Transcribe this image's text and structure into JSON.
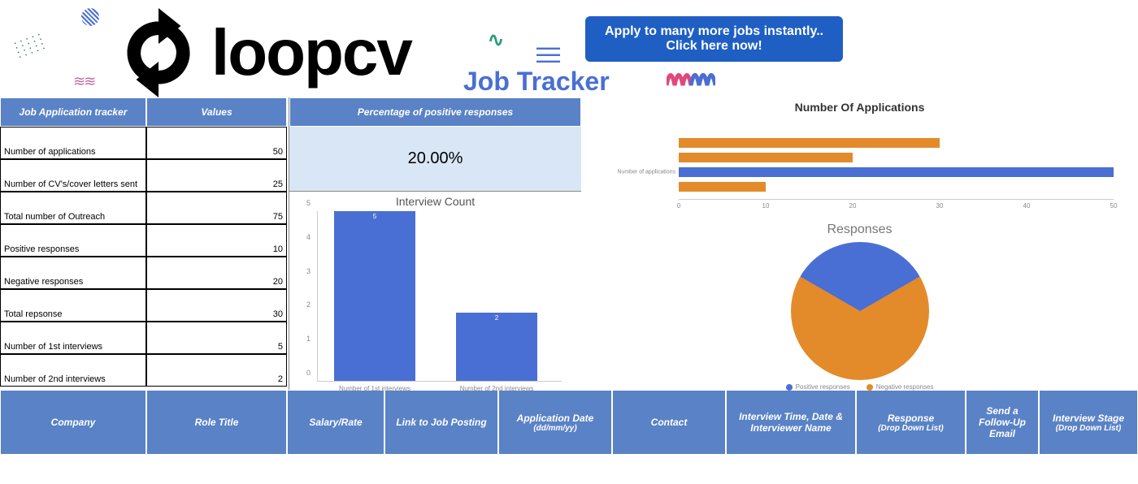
{
  "header": {
    "logo_text": "loopcv",
    "tracker_label": "Job Tracker",
    "apply_button_line1": "Apply to many more jobs instantly..",
    "apply_button_line2": "Click here now!"
  },
  "stats_table": {
    "header_label": "Job Application tracker",
    "header_values": "Values",
    "rows": [
      {
        "label": "Number of applications",
        "value": "50"
      },
      {
        "label": "Number of CV's/cover letters sent",
        "value": "25"
      },
      {
        "label": "Total number of Outreach",
        "value": "75"
      },
      {
        "label": "Positive responses",
        "value": "10"
      },
      {
        "label": "Negative responses",
        "value": "20"
      },
      {
        "label": "Total repsonse",
        "value": "30"
      },
      {
        "label": "Number of 1st interviews",
        "value": "5"
      },
      {
        "label": "Number of 2nd interviews",
        "value": "2"
      }
    ]
  },
  "percentage_panel": {
    "header": "Percentage of positive responses",
    "value": "20.00%"
  },
  "bottom_columns": [
    {
      "label": "Company",
      "sub": ""
    },
    {
      "label": "Role Title",
      "sub": ""
    },
    {
      "label": "Salary/Rate",
      "sub": ""
    },
    {
      "label": "Link to Job Posting",
      "sub": ""
    },
    {
      "label": "Application Date",
      "sub": "(dd/mm/yy)"
    },
    {
      "label": "Contact",
      "sub": ""
    },
    {
      "label": "Interview Time, Date & Interviewer Name",
      "sub": ""
    },
    {
      "label": "Response",
      "sub": "(Drop Down List)"
    },
    {
      "label": "Send a Follow-Up Email",
      "sub": ""
    },
    {
      "label": "Interview Stage",
      "sub": "(Drop Down List)"
    }
  ],
  "chart_data": [
    {
      "type": "bar",
      "title": "Interview Count",
      "categories": [
        "Number of 1st interviews",
        "Number of 2nd interviews"
      ],
      "values": [
        5,
        2
      ],
      "ylim": [
        0,
        5
      ]
    },
    {
      "type": "bar",
      "orientation": "horizontal",
      "title": "Number Of Applications",
      "categories": [
        "",
        "",
        "",
        "Number of applications",
        ""
      ],
      "values": [
        0,
        30,
        20,
        50,
        10
      ],
      "colors": [
        "",
        "#e38b2a",
        "#e38b2a",
        "#4a6fd4",
        "#e38b2a"
      ],
      "xlim": [
        0,
        50
      ],
      "xticks": [
        0,
        10,
        20,
        30,
        40,
        50
      ]
    },
    {
      "type": "pie",
      "title": "Responses",
      "series": [
        {
          "name": "Positive responses",
          "value": 10,
          "color": "#4a6fd4"
        },
        {
          "name": "Negative responses",
          "value": 20,
          "color": "#e38b2a"
        }
      ]
    }
  ],
  "colors": {
    "blue": "#4a6fd4",
    "orange": "#e38b2a",
    "header_bg": "#5a82c6"
  }
}
